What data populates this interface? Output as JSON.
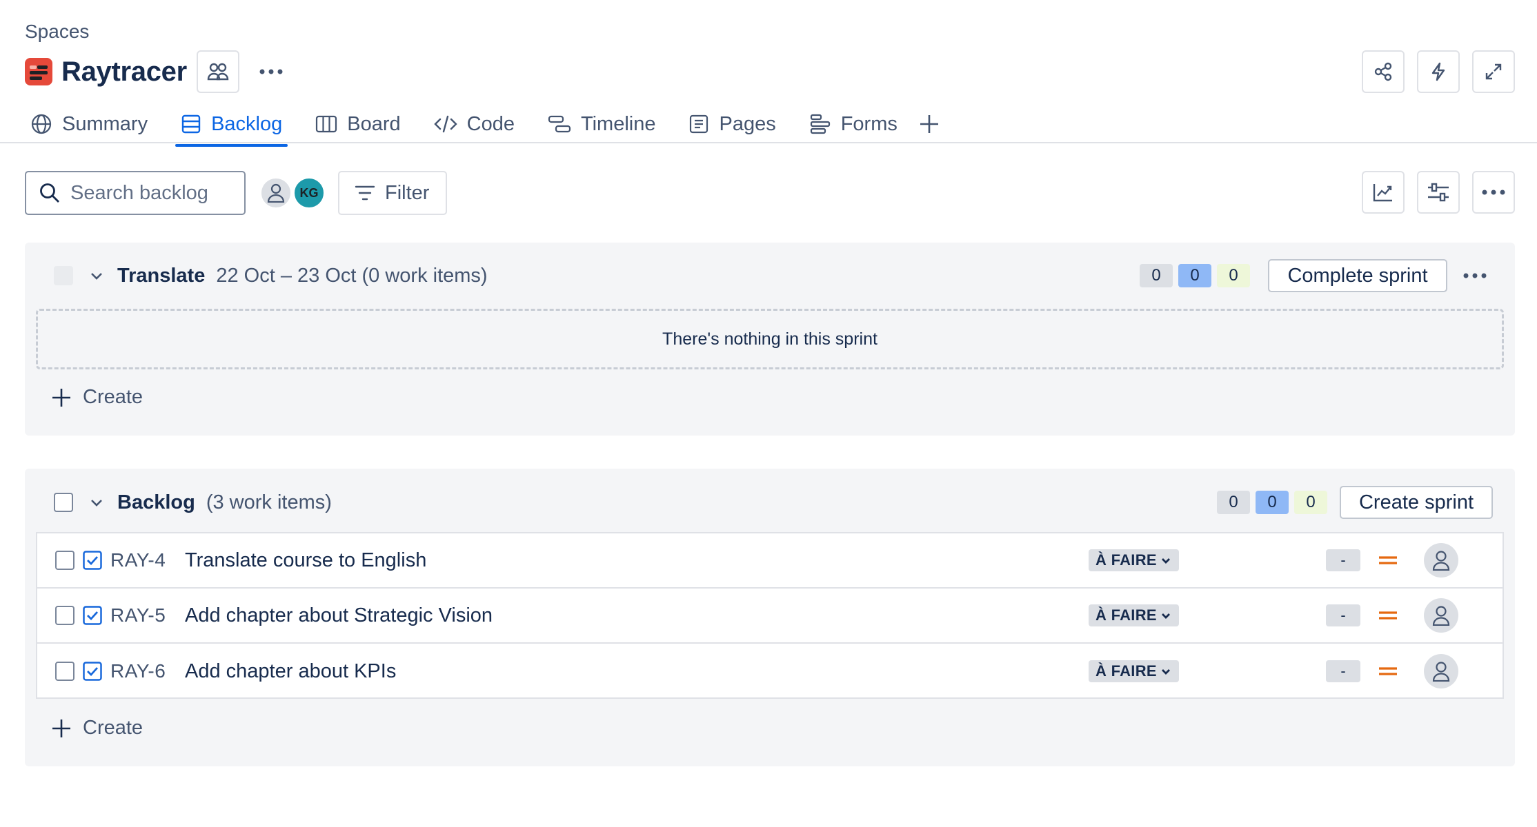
{
  "breadcrumb": "Spaces",
  "project": {
    "title": "Raytracer",
    "logo_color": "#e5493a"
  },
  "tabs": [
    {
      "label": "Summary",
      "icon": "globe-icon",
      "active": false
    },
    {
      "label": "Backlog",
      "icon": "backlog-icon",
      "active": true
    },
    {
      "label": "Board",
      "icon": "board-icon",
      "active": false
    },
    {
      "label": "Code",
      "icon": "code-icon",
      "active": false
    },
    {
      "label": "Timeline",
      "icon": "timeline-icon",
      "active": false
    },
    {
      "label": "Pages",
      "icon": "pages-icon",
      "active": false
    },
    {
      "label": "Forms",
      "icon": "forms-icon",
      "active": false
    }
  ],
  "toolbar": {
    "search_placeholder": "Search backlog",
    "avatar_initials": "KG",
    "filter_label": "Filter"
  },
  "sprint": {
    "name": "Translate",
    "meta": "22 Oct – 23 Oct (0 work items)",
    "counts": {
      "todo": "0",
      "in_progress": "0",
      "done": "0"
    },
    "complete_label": "Complete sprint",
    "empty_text": "There's nothing in this sprint",
    "create_label": "Create"
  },
  "backlog": {
    "name": "Backlog",
    "meta": "(3 work items)",
    "counts": {
      "todo": "0",
      "in_progress": "0",
      "done": "0"
    },
    "create_sprint_label": "Create sprint",
    "create_label": "Create",
    "items": [
      {
        "key": "RAY-4",
        "summary": "Translate course to English",
        "status": "À FAIRE",
        "estimate": "-",
        "priority": "medium"
      },
      {
        "key": "RAY-5",
        "summary": "Add chapter about Strategic Vision",
        "status": "À FAIRE",
        "estimate": "-",
        "priority": "medium"
      },
      {
        "key": "RAY-6",
        "summary": "Add chapter about KPIs",
        "status": "À FAIRE",
        "estimate": "-",
        "priority": "medium"
      }
    ]
  },
  "colors": {
    "accent": "#0c66e4",
    "priority_medium": "#e56910",
    "task_blue": "#1868db",
    "count_blue": "#8fb8f6",
    "count_green": "#eef7d9"
  }
}
